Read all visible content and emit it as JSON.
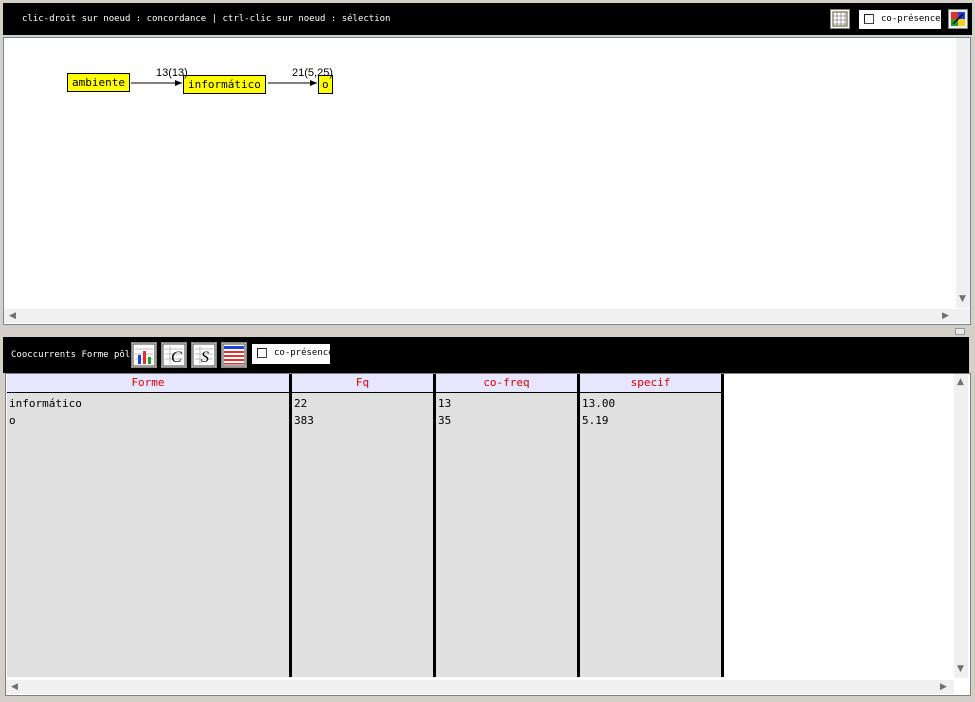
{
  "top_bar": {
    "hint_text": "clic-droit sur noeud : concordance | ctrl-clic sur noeud : sélection",
    "copresence_label": "co-présence",
    "grid_icon": "grid-icon",
    "palette_icon": "palette-icon"
  },
  "graph": {
    "nodes": [
      {
        "label": "ambiente"
      },
      {
        "label": "informático"
      },
      {
        "label": "o"
      }
    ],
    "edges": [
      {
        "label": "13(13)"
      },
      {
        "label": "21(5,25)"
      }
    ]
  },
  "bottom_bar": {
    "title": "Cooccurrents Forme pôle",
    "copresence_label": "co-présence",
    "icons": [
      "chart-icon",
      "concordance-icon",
      "specif-icon",
      "table-icon"
    ]
  },
  "table": {
    "headers": [
      "Forme",
      "Fq",
      "co-freq",
      "specif"
    ],
    "rows": [
      [
        "informático",
        "22",
        "13",
        "13.00"
      ],
      [
        "o",
        "383",
        "35",
        "5.19"
      ]
    ]
  }
}
